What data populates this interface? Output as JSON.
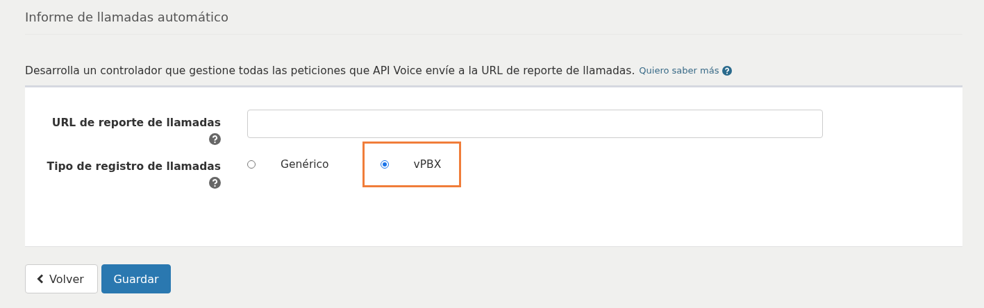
{
  "title": "Informe de llamadas automático",
  "description": "Desarrolla un controlador que gestione todas las peticiones que API Voice envíe a la URL de reporte de llamadas.",
  "help_link": "Quiero saber más",
  "form": {
    "fields": [
      {
        "kind": "text",
        "label": "URL de reporte de llamadas"
      },
      {
        "kind": "radio",
        "label": "Tipo de registro de llamadas",
        "options": [
          {
            "label": "Genérico",
            "selected": false,
            "highlighted": false
          },
          {
            "label": "vPBX",
            "selected": true,
            "highlighted": true
          }
        ]
      }
    ]
  },
  "buttons": [
    {
      "label": "Volver",
      "kind": "back"
    },
    {
      "label": "Guardar",
      "kind": "primary"
    }
  ]
}
